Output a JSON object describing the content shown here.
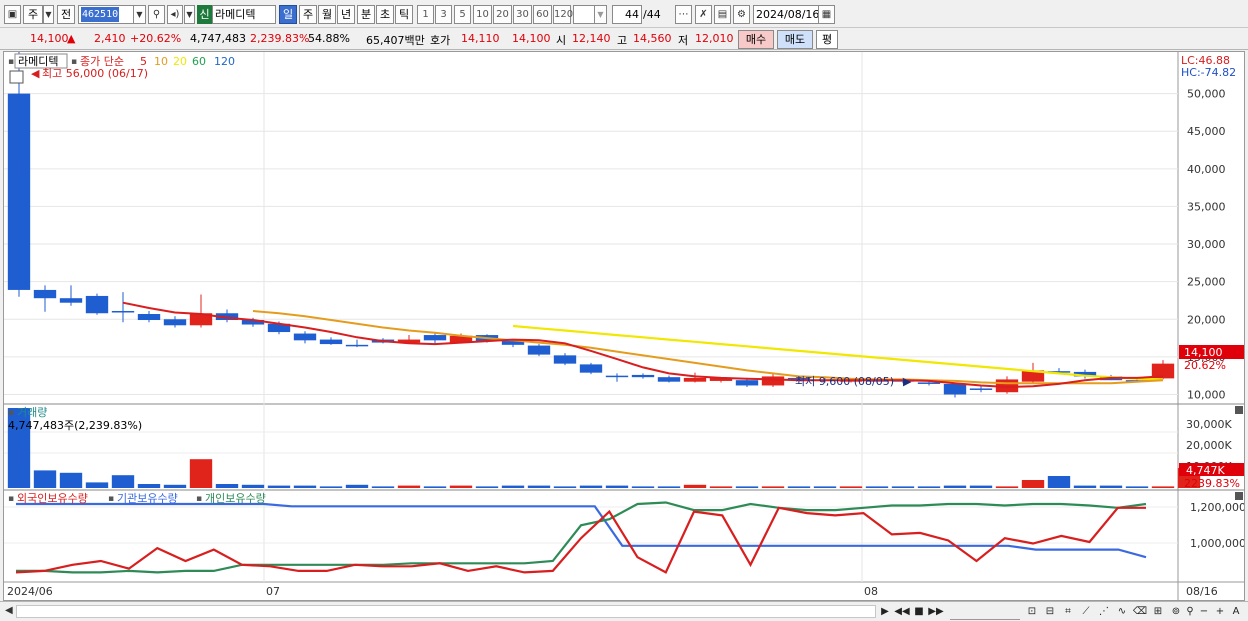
{
  "toolbar": {
    "period_label": "주",
    "prev_label": "전",
    "code_value": "462510",
    "badge": "신",
    "stock_name": "라메디텍",
    "periods": [
      "일",
      "주",
      "월",
      "년",
      "분",
      "초",
      "틱"
    ],
    "active_period": "일",
    "intervals": [
      "1",
      "3",
      "5",
      "10",
      "20",
      "30",
      "60",
      "120"
    ],
    "page_counter": "44",
    "page_total": "/44",
    "date_value": "2024/08/16"
  },
  "quote": {
    "price": "14,100",
    "change_arrow": "▲",
    "change": "2,410",
    "change_pct": "+20.62%",
    "volume": "4,747,483",
    "volume_ratio": "2,239.83%",
    "turnover": "54.88%",
    "amount": "65,407백만",
    "bid_label": "호가",
    "bid1": "14,110",
    "bid2": "14,100",
    "open_label": "시",
    "open": "12,140",
    "high_label": "고",
    "high": "14,560",
    "low_label": "저",
    "low": "12,010",
    "buy_label": "매수",
    "sell_label": "매도",
    "eval_label": "평"
  },
  "price_panel": {
    "stock_tag": "라메디텍",
    "legend_title": "종가 단순",
    "ma_labels": [
      "5",
      "10",
      "20",
      "60",
      "120"
    ],
    "ma_colors": [
      "#d81e1e",
      "#e59c1c",
      "#f0e800",
      "#22a050",
      "#1e68c8"
    ],
    "high_note": "최고 56,000 (06/17)",
    "low_note": "최저 9,600 (08/05)",
    "lc": "LC:46.88",
    "hc": "HC:-74.82",
    "y_ticks": [
      "50,000",
      "45,000",
      "40,000",
      "35,000",
      "30,000",
      "25,000",
      "20,000",
      "15,000",
      "10,000"
    ],
    "cur_price_tag": "14,100",
    "cur_pct_tag": "20.62%"
  },
  "volume_panel": {
    "title": "거래량",
    "info": "4,747,483주(2,239.83%)",
    "y_ticks": [
      "30,000K",
      "20,000K",
      "10,000K"
    ],
    "cur_tag": "4,747K",
    "cur_pct": "2239.83%"
  },
  "holding_panel": {
    "legend": [
      "외국인보유수량",
      "기관보유수량",
      "개인보유수량"
    ],
    "legend_colors": [
      "#d81e1e",
      "#3b6ae0",
      "#2e8b57"
    ],
    "y_ticks": [
      "1,200,000",
      "1,000,000"
    ]
  },
  "x_axis": {
    "labels": [
      "2024/06",
      "07",
      "08"
    ],
    "end_label": "08/16"
  },
  "chart_data": {
    "type": "candlestick",
    "ylim": [
      9000,
      55000
    ],
    "candles": [
      {
        "o": 50000,
        "h": 56000,
        "l": 23000,
        "c": 23900
      },
      {
        "o": 23900,
        "h": 24500,
        "l": 21000,
        "c": 22800
      },
      {
        "o": 22800,
        "h": 24500,
        "l": 21800,
        "c": 22200
      },
      {
        "o": 23100,
        "h": 23400,
        "l": 20600,
        "c": 20800
      },
      {
        "o": 21100,
        "h": 23600,
        "l": 19600,
        "c": 20900
      },
      {
        "o": 20700,
        "h": 21100,
        "l": 19600,
        "c": 19900
      },
      {
        "o": 20000,
        "h": 20400,
        "l": 18900,
        "c": 19200
      },
      {
        "o": 19200,
        "h": 23300,
        "l": 18900,
        "c": 20800
      },
      {
        "o": 20800,
        "h": 21300,
        "l": 19600,
        "c": 19900
      },
      {
        "o": 19900,
        "h": 20200,
        "l": 19000,
        "c": 19300
      },
      {
        "o": 19400,
        "h": 19700,
        "l": 18000,
        "c": 18300
      },
      {
        "o": 18100,
        "h": 18400,
        "l": 16800,
        "c": 17200
      },
      {
        "o": 17300,
        "h": 17600,
        "l": 16600,
        "c": 16700
      },
      {
        "o": 16600,
        "h": 17300,
        "l": 16300,
        "c": 16500
      },
      {
        "o": 17300,
        "h": 17500,
        "l": 16800,
        "c": 16900
      },
      {
        "o": 16900,
        "h": 17900,
        "l": 16800,
        "c": 17300
      },
      {
        "o": 17900,
        "h": 18100,
        "l": 16800,
        "c": 17200
      },
      {
        "o": 16900,
        "h": 18100,
        "l": 16800,
        "c": 17800
      },
      {
        "o": 17900,
        "h": 18000,
        "l": 16900,
        "c": 17100
      },
      {
        "o": 17100,
        "h": 17300,
        "l": 16300,
        "c": 16600
      },
      {
        "o": 16500,
        "h": 16700,
        "l": 15100,
        "c": 15300
      },
      {
        "o": 15200,
        "h": 15500,
        "l": 13900,
        "c": 14100
      },
      {
        "o": 14000,
        "h": 14200,
        "l": 12700,
        "c": 12900
      },
      {
        "o": 12500,
        "h": 12800,
        "l": 11700,
        "c": 12300
      },
      {
        "o": 12600,
        "h": 12800,
        "l": 12100,
        "c": 12300
      },
      {
        "o": 12300,
        "h": 12500,
        "l": 11600,
        "c": 11700
      },
      {
        "o": 11700,
        "h": 12900,
        "l": 11600,
        "c": 12200
      },
      {
        "o": 11800,
        "h": 12300,
        "l": 11600,
        "c": 12200
      },
      {
        "o": 11900,
        "h": 12200,
        "l": 11000,
        "c": 11200
      },
      {
        "o": 11200,
        "h": 12900,
        "l": 11000,
        "c": 12400
      },
      {
        "o": 12200,
        "h": 12400,
        "l": 11700,
        "c": 11900
      },
      {
        "o": 12000,
        "h": 12200,
        "l": 11600,
        "c": 11800
      },
      {
        "o": 11800,
        "h": 12100,
        "l": 11600,
        "c": 11900
      },
      {
        "o": 11900,
        "h": 12100,
        "l": 11500,
        "c": 11800
      },
      {
        "o": 12000,
        "h": 12200,
        "l": 11500,
        "c": 11700
      },
      {
        "o": 11600,
        "h": 11800,
        "l": 11200,
        "c": 11500
      },
      {
        "o": 11400,
        "h": 11600,
        "l": 9600,
        "c": 10000
      },
      {
        "o": 10800,
        "h": 11200,
        "l": 10300,
        "c": 10600
      },
      {
        "o": 10300,
        "h": 12400,
        "l": 10100,
        "c": 12000
      },
      {
        "o": 11700,
        "h": 14200,
        "l": 11500,
        "c": 13200
      },
      {
        "o": 13100,
        "h": 13500,
        "l": 12700,
        "c": 12900
      },
      {
        "o": 13000,
        "h": 13300,
        "l": 12100,
        "c": 12400
      },
      {
        "o": 12400,
        "h": 12600,
        "l": 11900,
        "c": 11900
      },
      {
        "o": 11900,
        "h": 12200,
        "l": 11600,
        "c": 11800
      },
      {
        "o": 12140,
        "h": 14560,
        "l": 12010,
        "c": 14100
      }
    ],
    "ma5": [
      null,
      null,
      null,
      null,
      22200,
      21500,
      20900,
      20700,
      20200,
      19900,
      19400,
      18900,
      18300,
      17600,
      17100,
      16800,
      16700,
      16900,
      17100,
      17300,
      17200,
      16800,
      15800,
      14700,
      13600,
      12800,
      12400,
      12200,
      12100,
      12000,
      11900,
      11900,
      11900,
      11900,
      11900,
      11800,
      11500,
      11200,
      11000,
      11100,
      11400,
      11900,
      12200,
      12200,
      12400
    ],
    "ma10": [
      null,
      null,
      null,
      null,
      null,
      null,
      null,
      null,
      null,
      21100,
      20800,
      20400,
      19900,
      19400,
      18900,
      18500,
      18200,
      17800,
      17500,
      17200,
      16900,
      16600,
      16200,
      15700,
      15200,
      14700,
      14200,
      13700,
      13200,
      12800,
      12400,
      12300,
      12100,
      12000,
      12000,
      11900,
      11800,
      11600,
      11500,
      11500,
      11500,
      11500,
      11500,
      11700,
      11900
    ],
    "ma20": [
      null,
      null,
      null,
      null,
      null,
      null,
      null,
      null,
      null,
      null,
      null,
      null,
      null,
      null,
      null,
      null,
      null,
      null,
      null,
      19100,
      18800,
      18500,
      18200,
      17900,
      17600,
      17300,
      17000,
      16700,
      16400,
      16100,
      15800,
      15500,
      15200,
      14900,
      14600,
      14300,
      14000,
      13700,
      13400,
      13100,
      12800,
      12500,
      12300,
      12100,
      12000
    ],
    "volume_rel": [
      1.0,
      0.22,
      0.19,
      0.07,
      0.16,
      0.05,
      0.04,
      0.36,
      0.05,
      0.04,
      0.03,
      0.03,
      0.02,
      0.04,
      0.02,
      0.03,
      0.02,
      0.03,
      0.02,
      0.03,
      0.03,
      0.02,
      0.03,
      0.03,
      0.02,
      0.02,
      0.04,
      0.02,
      0.02,
      0.02,
      0.02,
      0.02,
      0.02,
      0.02,
      0.02,
      0.02,
      0.03,
      0.03,
      0.02,
      0.1,
      0.15,
      0.03,
      0.03,
      0.02,
      0.02,
      0.25
    ],
    "foreign": [
      0.1,
      0.12,
      0.2,
      0.25,
      0.15,
      0.42,
      0.25,
      0.4,
      0.2,
      0.18,
      0.12,
      0.12,
      0.2,
      0.18,
      0.18,
      0.22,
      0.12,
      0.18,
      0.1,
      0.12,
      0.55,
      0.9,
      0.3,
      0.1,
      0.9,
      0.85,
      0.2,
      0.95,
      0.88,
      0.85,
      0.88,
      0.6,
      0.62,
      0.52,
      0.25,
      0.55,
      0.48,
      0.58,
      0.5,
      0.95,
      0.95
    ],
    "inst": [
      1.0,
      1.0,
      1.0,
      1.0,
      1.0,
      1.0,
      1.0,
      1.0,
      1.0,
      1.0,
      0.97,
      0.97,
      0.97,
      0.97,
      0.97,
      0.97,
      0.97,
      0.97,
      0.97,
      0.97,
      0.97,
      0.97,
      0.45,
      0.45,
      0.45,
      0.45,
      0.45,
      0.45,
      0.45,
      0.45,
      0.45,
      0.45,
      0.45,
      0.45,
      0.45,
      0.45,
      0.45,
      0.4,
      0.4,
      0.4,
      0.4,
      0.3
    ],
    "indiv": [
      0.12,
      0.12,
      0.1,
      0.1,
      0.12,
      0.1,
      0.12,
      0.12,
      0.2,
      0.2,
      0.2,
      0.2,
      0.2,
      0.2,
      0.22,
      0.22,
      0.22,
      0.22,
      0.22,
      0.25,
      0.72,
      0.8,
      1.0,
      1.02,
      0.92,
      0.92,
      1.0,
      0.95,
      0.92,
      0.92,
      0.95,
      0.98,
      0.98,
      1.0,
      1.0,
      0.98,
      1.0,
      1.0,
      0.98,
      0.95,
      1.0
    ]
  }
}
